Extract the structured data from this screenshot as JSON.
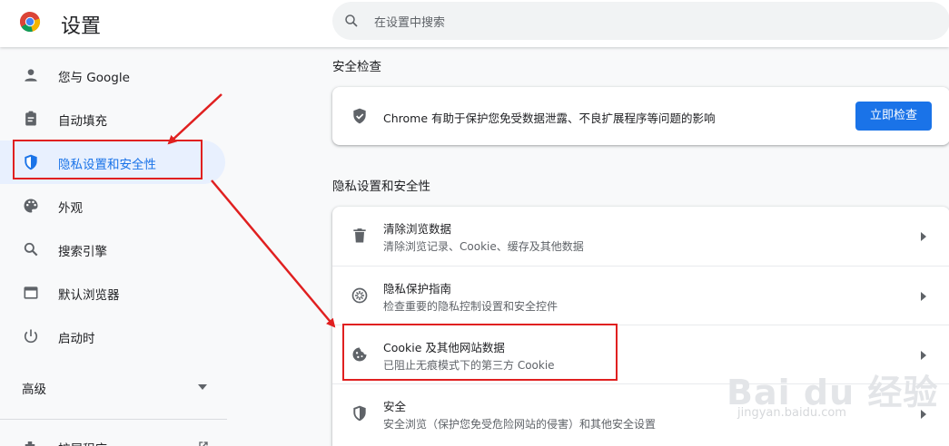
{
  "header": {
    "title": "设置",
    "search_placeholder": "在设置中搜索"
  },
  "sidebar": {
    "items": [
      {
        "label": "您与 Google",
        "icon": "person-icon"
      },
      {
        "label": "自动填充",
        "icon": "clipboard-icon"
      },
      {
        "label": "隐私设置和安全性",
        "icon": "shield-icon",
        "active": true
      },
      {
        "label": "外观",
        "icon": "palette-icon"
      },
      {
        "label": "搜索引擎",
        "icon": "search-icon"
      },
      {
        "label": "默认浏览器",
        "icon": "browser-icon"
      },
      {
        "label": "启动时",
        "icon": "power-icon"
      }
    ],
    "advanced_label": "高级",
    "extensions_label": "扩展程序"
  },
  "safety_check": {
    "section_title": "安全检查",
    "description": "Chrome 有助于保护您免受数据泄露、不良扩展程序等问题的影响",
    "button_label": "立即检查"
  },
  "privacy": {
    "section_title": "隐私设置和安全性",
    "rows": [
      {
        "title": "清除浏览数据",
        "subtitle": "清除浏览记录、Cookie、缓存及其他数据",
        "icon": "trash-icon"
      },
      {
        "title": "隐私保护指南",
        "subtitle": "检查重要的隐私控制设置和安全控件",
        "icon": "privacy-guide-icon"
      },
      {
        "title": "Cookie 及其他网站数据",
        "subtitle": "已阻止无痕模式下的第三方 Cookie",
        "icon": "cookie-icon"
      },
      {
        "title": "安全",
        "subtitle": "安全浏览（保护您免受危险网站的侵害）和其他安全设置",
        "icon": "security-shield-icon"
      }
    ]
  },
  "watermark": {
    "brand": "Bai du 经验",
    "url": "jingyan.baidu.com"
  },
  "colors": {
    "accent": "#1a73e8",
    "active_bg": "#e8f0fe",
    "annotation_red": "#e02020"
  }
}
